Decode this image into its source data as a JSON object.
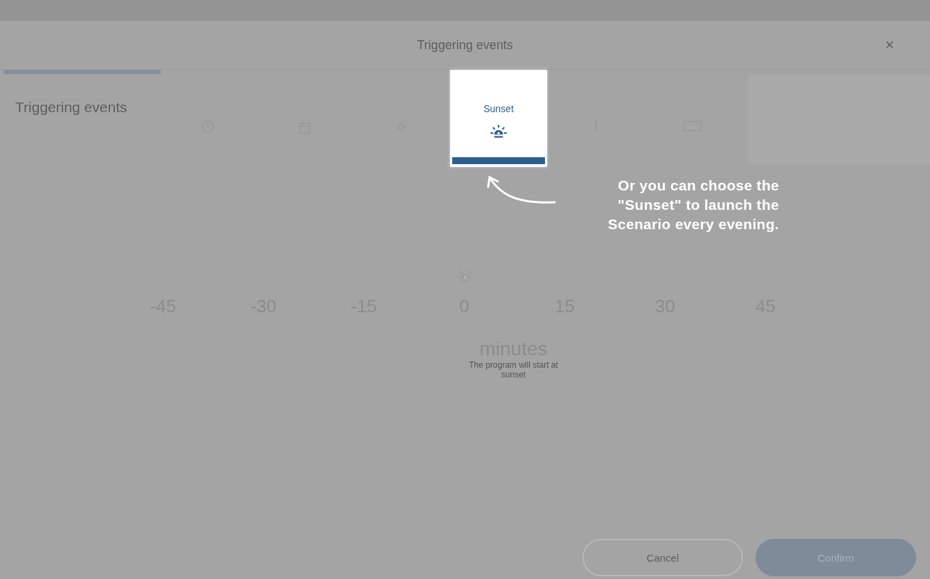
{
  "header": {
    "title": "Triggering events",
    "close": "×"
  },
  "progress": {
    "level": 0.17
  },
  "sidebar": {
    "label": "Triggering events"
  },
  "tabs": [
    {
      "kind": "clock",
      "selected": false
    },
    {
      "kind": "calendar",
      "selected": false
    },
    {
      "kind": "sunrise",
      "selected": false
    },
    {
      "kind": "sunset",
      "label": "Sunset",
      "selected": true
    },
    {
      "kind": "digit",
      "selected": false
    },
    {
      "kind": "badge",
      "selected": false
    }
  ],
  "scale": {
    "ticks": [
      "-45",
      "-30",
      "-15",
      "0",
      "15",
      "30",
      "45"
    ],
    "unit": "minutes",
    "note": "The program will start at sunset"
  },
  "buttons": [
    {
      "label": "Cancel",
      "kind": "outline"
    },
    {
      "label": "Confirm",
      "kind": "filled"
    }
  ],
  "callout": {
    "text": "Or you can choose the \"Sunset\" to launch the Scenario every evening."
  }
}
